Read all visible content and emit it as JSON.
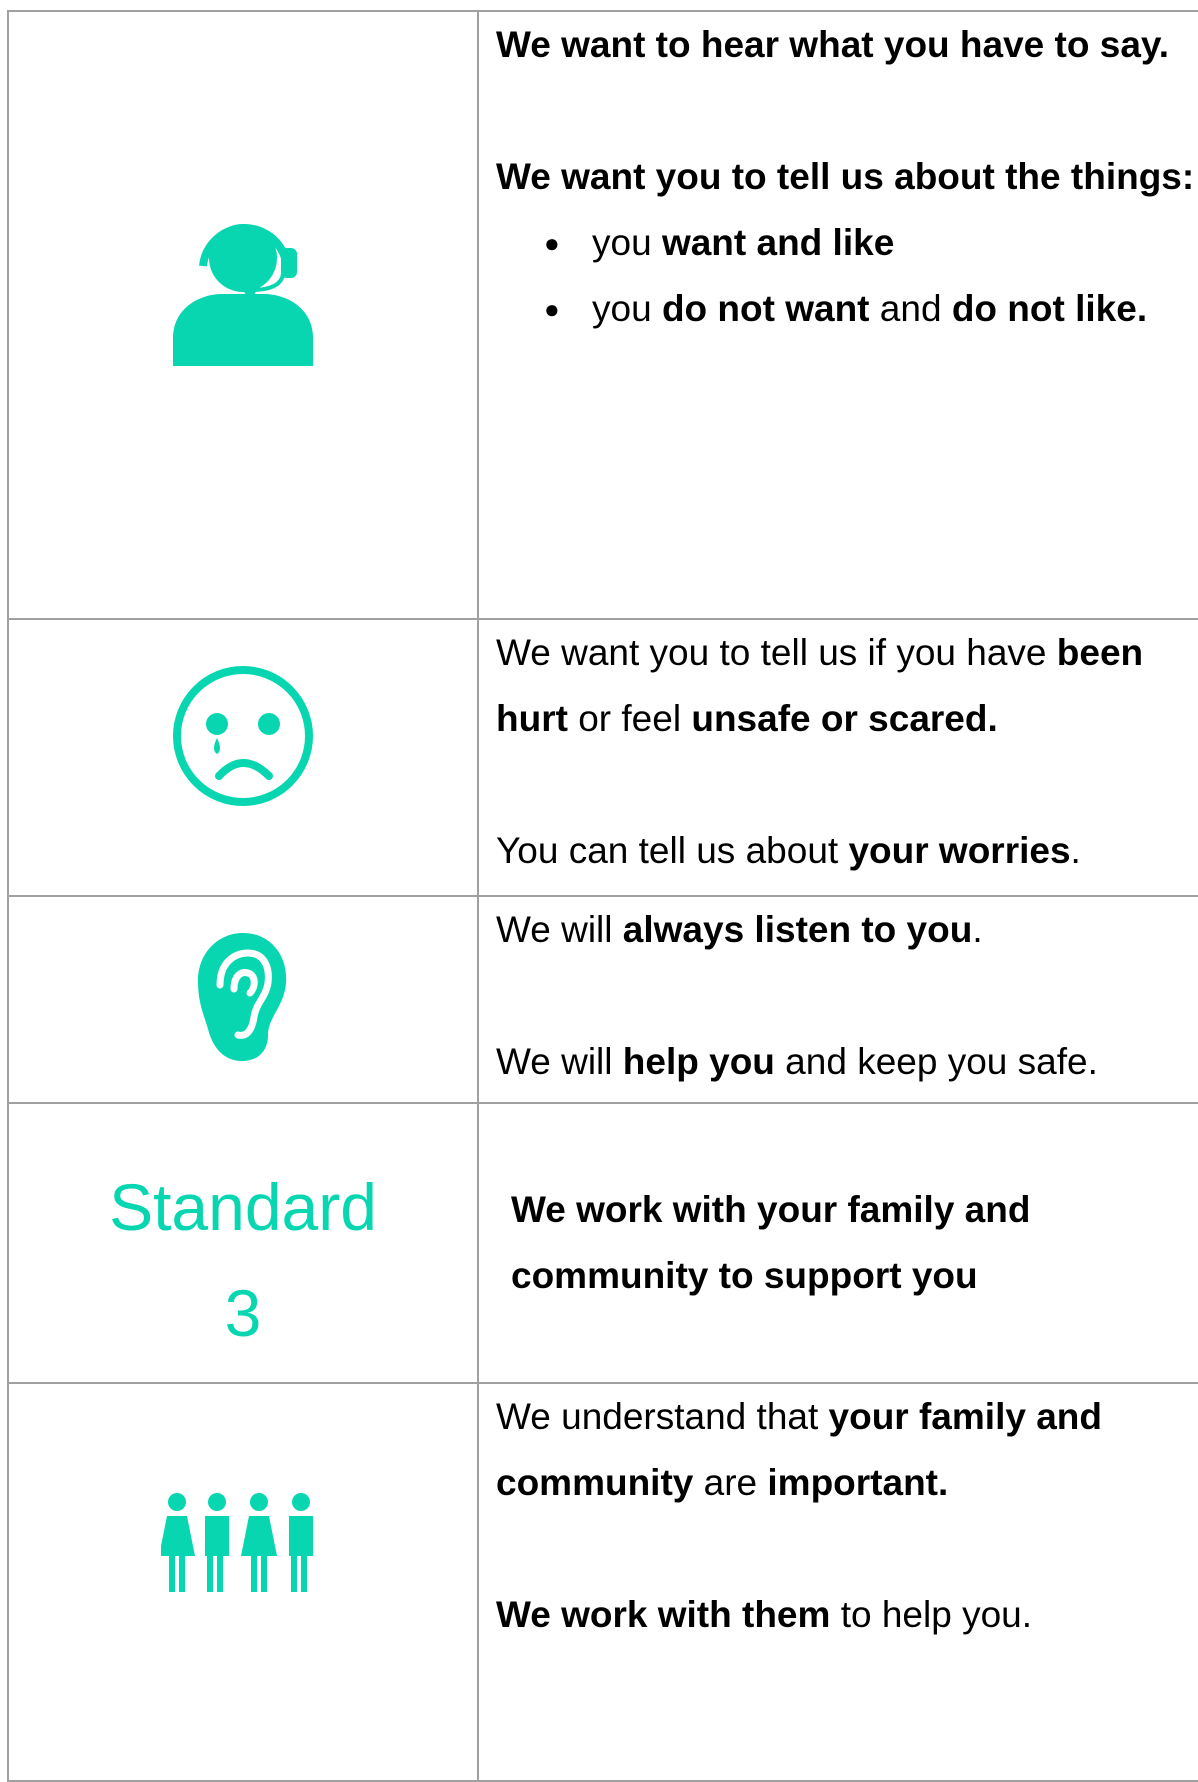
{
  "colors": {
    "accent": "#07d6b0",
    "border": "#a0a0a0",
    "text": "#000000"
  },
  "rows": [
    {
      "icon": "headset-person-icon",
      "heading1": "We want to hear what you have to say.",
      "heading2": "We want you to tell us about the things:",
      "bullets": [
        {
          "pre": "you ",
          "b1": "want and like",
          "mid": "",
          "b2": "",
          "post": ""
        },
        {
          "pre": "you ",
          "b1": "do not want",
          "mid": " and ",
          "b2": "do not like.",
          "post": ""
        }
      ]
    },
    {
      "icon": "sad-face-icon",
      "p1": {
        "pre": "We want you to tell us if you have ",
        "b1": "been hurt",
        "mid": " or feel ",
        "b2": "unsafe or scared."
      },
      "p2": {
        "pre": "You can tell us about ",
        "b1": "your worries",
        "post": "."
      }
    },
    {
      "icon": "ear-icon",
      "p1": {
        "pre": "We will ",
        "b1": "always listen to you",
        "post": "."
      },
      "p2": {
        "pre": "We will ",
        "b1": "help you",
        "post": " and keep you safe."
      }
    },
    {
      "label_line1": "Standard",
      "label_line2": "3",
      "title": "We work with your family and community to support you"
    },
    {
      "icon": "family-group-icon",
      "p1": {
        "pre": "We understand that ",
        "b1": "your family and community",
        "mid": " are ",
        "b2": "important."
      },
      "p2": {
        "b1": "We work with them",
        "post": " to help you."
      }
    }
  ]
}
